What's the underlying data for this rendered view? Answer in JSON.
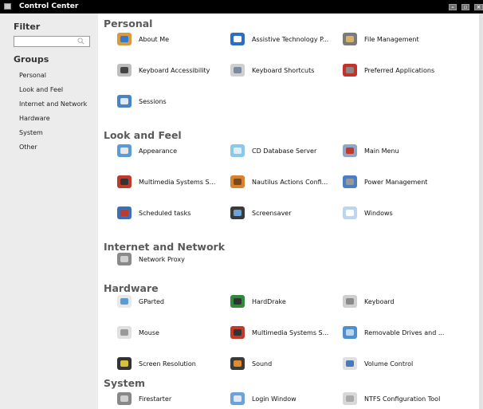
{
  "window": {
    "title": "Control Center"
  },
  "sidebar": {
    "filter_title": "Filter",
    "filter_value": "",
    "groups_title": "Groups",
    "groups": [
      "Personal",
      "Look and Feel",
      "Internet and Network",
      "Hardware",
      "System",
      "Other"
    ]
  },
  "sections": [
    {
      "title": "Personal",
      "items": [
        {
          "label": "About Me",
          "icon": "about-me-icon"
        },
        {
          "label": "Assistive Technology P...",
          "icon": "accessibility-icon"
        },
        {
          "label": "File Management",
          "icon": "file-management-icon"
        },
        {
          "label": "Keyboard Accessibility",
          "icon": "keyboard-accessibility-icon"
        },
        {
          "label": "Keyboard Shortcuts",
          "icon": "keyboard-shortcuts-icon"
        },
        {
          "label": "Preferred Applications",
          "icon": "preferred-applications-icon"
        },
        {
          "label": "Sessions",
          "icon": "sessions-icon"
        }
      ]
    },
    {
      "title": "Look and Feel",
      "items": [
        {
          "label": "Appearance",
          "icon": "appearance-icon"
        },
        {
          "label": "CD Database Server",
          "icon": "cd-database-icon"
        },
        {
          "label": "Main Menu",
          "icon": "main-menu-icon"
        },
        {
          "label": "Multimedia Systems S...",
          "icon": "multimedia-icon"
        },
        {
          "label": "Nautilus Actions Confi...",
          "icon": "nautilus-actions-icon"
        },
        {
          "label": "Power Management",
          "icon": "power-management-icon"
        },
        {
          "label": "Scheduled tasks",
          "icon": "scheduled-tasks-icon"
        },
        {
          "label": "Screensaver",
          "icon": "screensaver-icon"
        },
        {
          "label": "Windows",
          "icon": "windows-icon"
        }
      ]
    },
    {
      "title": "Internet and Network",
      "items": [
        {
          "label": "Network Proxy",
          "icon": "network-proxy-icon"
        }
      ]
    },
    {
      "title": "Hardware",
      "items": [
        {
          "label": "GParted",
          "icon": "gparted-icon"
        },
        {
          "label": "HardDrake",
          "icon": "harddrake-icon"
        },
        {
          "label": "Keyboard",
          "icon": "keyboard-icon"
        },
        {
          "label": "Mouse",
          "icon": "mouse-icon"
        },
        {
          "label": "Multimedia Systems S...",
          "icon": "multimedia-icon"
        },
        {
          "label": "Removable Drives and ...",
          "icon": "removable-drives-icon"
        },
        {
          "label": "Screen Resolution",
          "icon": "screen-resolution-icon"
        },
        {
          "label": "Sound",
          "icon": "sound-icon"
        },
        {
          "label": "Volume Control",
          "icon": "volume-control-icon"
        }
      ]
    },
    {
      "title": "System",
      "items": [
        {
          "label": "Firestarter",
          "icon": "firestarter-icon"
        },
        {
          "label": "Login Window",
          "icon": "login-window-icon"
        },
        {
          "label": "NTFS Configuration Tool",
          "icon": "ntfs-config-icon"
        }
      ]
    }
  ]
}
